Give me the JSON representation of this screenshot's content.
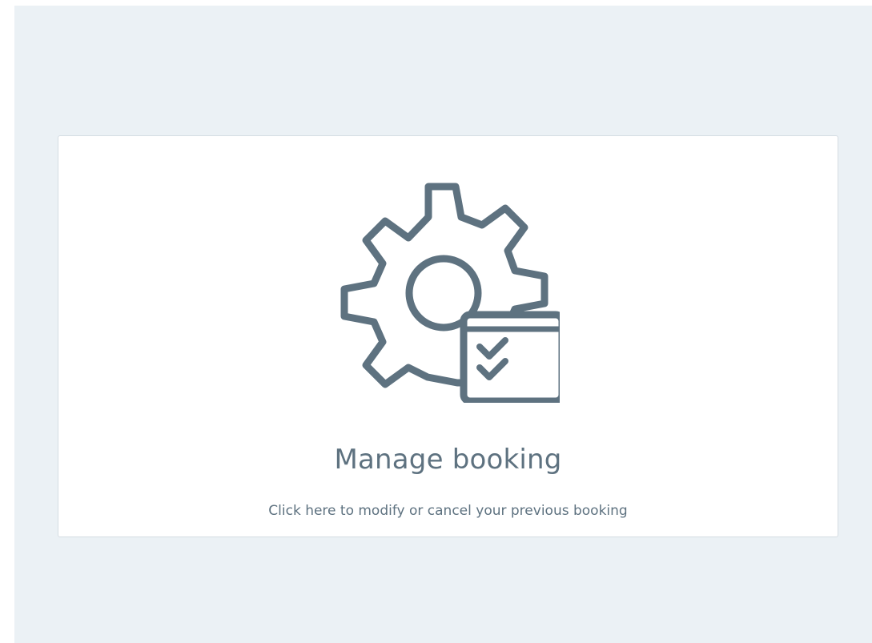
{
  "manage_booking": {
    "title": "Manage booking",
    "description": "Click here to modify or cancel your previous booking",
    "icon": "gear-calendar-check-icon"
  },
  "colors": {
    "background": "#ebf1f5",
    "card": "#ffffff",
    "icon_stroke": "#5e7280",
    "text": "#5e7280"
  }
}
